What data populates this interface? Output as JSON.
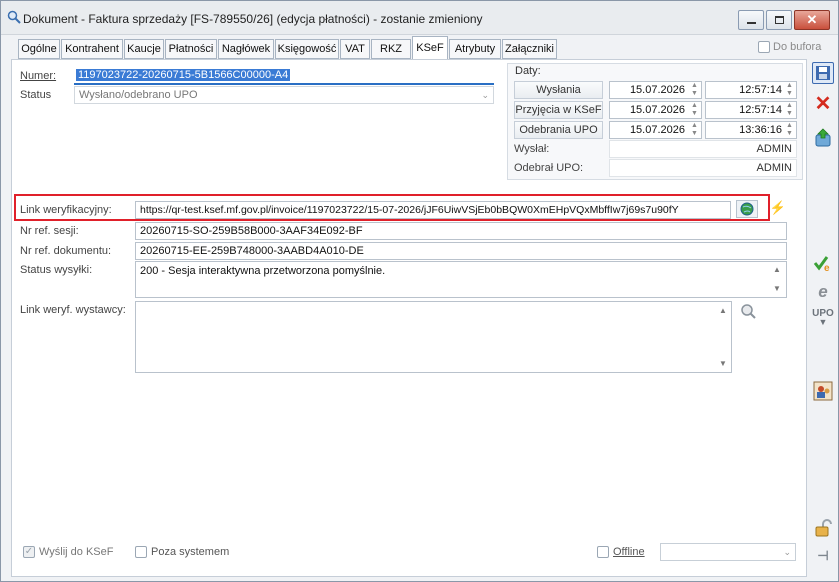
{
  "window": {
    "title": "Dokument - Faktura sprzedaży [FS-789550/26] (edycja płatności) - zostanie zmieniony"
  },
  "tabs": [
    {
      "label": "Ogólne"
    },
    {
      "label": "Kontrahent"
    },
    {
      "label": "Kaucje"
    },
    {
      "label": "Płatności"
    },
    {
      "label": "Nagłówek"
    },
    {
      "label": "Księgowość"
    },
    {
      "label": "VAT"
    },
    {
      "label": "RKZ"
    },
    {
      "label": "KSeF"
    },
    {
      "label": "Atrybuty"
    },
    {
      "label": "Załączniki"
    }
  ],
  "active_tab": "KSeF",
  "do_bufora": {
    "label": "Do bufora",
    "checked": false
  },
  "form": {
    "numer_label": "Numer:",
    "numer_value": "1197023722-20260715-5B1566C00000-A4",
    "status_label": "Status",
    "status_value": "Wysłano/odebrano UPO",
    "daty_label": "Daty:",
    "wyslania_label": "Wysłania",
    "wyslania_date": "15.07.2026",
    "wyslania_time": "12:57:14",
    "przyjecia_label": "Przyjęcia w KSeF",
    "przyjecia_date": "15.07.2026",
    "przyjecia_time": "12:57:14",
    "odebrania_label": "Odebrania UPO",
    "odebrania_date": "15.07.2026",
    "odebrania_time": "13:36:16",
    "wyslal_label": "Wysłał:",
    "wyslal_value": "ADMIN",
    "odebral_label": "Odebrał UPO:",
    "odebral_value": "ADMIN",
    "link_label": "Link weryfikacyjny:",
    "link_value": "https://qr-test.ksef.mf.gov.pl/invoice/1197023722/15-07-2026/jJF6UiwVSjEb0bBQW0XmEHpVQxMbffIw7j69s7u90fY",
    "sesja_label": "Nr ref. sesji:",
    "sesja_value": "20260715-SO-259B58B000-3AAF34E092-BF",
    "dokument_label": "Nr ref. dokumentu:",
    "dokument_value": "20260715-EE-259B748000-3AABD4A010-DE",
    "status_wysylki_label": "Status wysyłki:",
    "status_wysylki_value": "200 - Sesja interaktywna przetworzona pomyślnie.",
    "link_wystawcy_label": "Link weryf. wystawcy:",
    "link_wystawcy_value": ""
  },
  "bottom": {
    "wyslij_label": "Wyślij do KSeF",
    "wyslij_checked": true,
    "poza_label": "Poza systemem",
    "poza_checked": false,
    "offline_label": "Offline",
    "offline_checked": false,
    "offline_select": ""
  },
  "side_toolbar": {
    "upo_label": "UPO"
  },
  "colors": {
    "accent": "#2a6fc4",
    "highlight_border": "#e0202a",
    "selection": "#3a7bd5"
  }
}
